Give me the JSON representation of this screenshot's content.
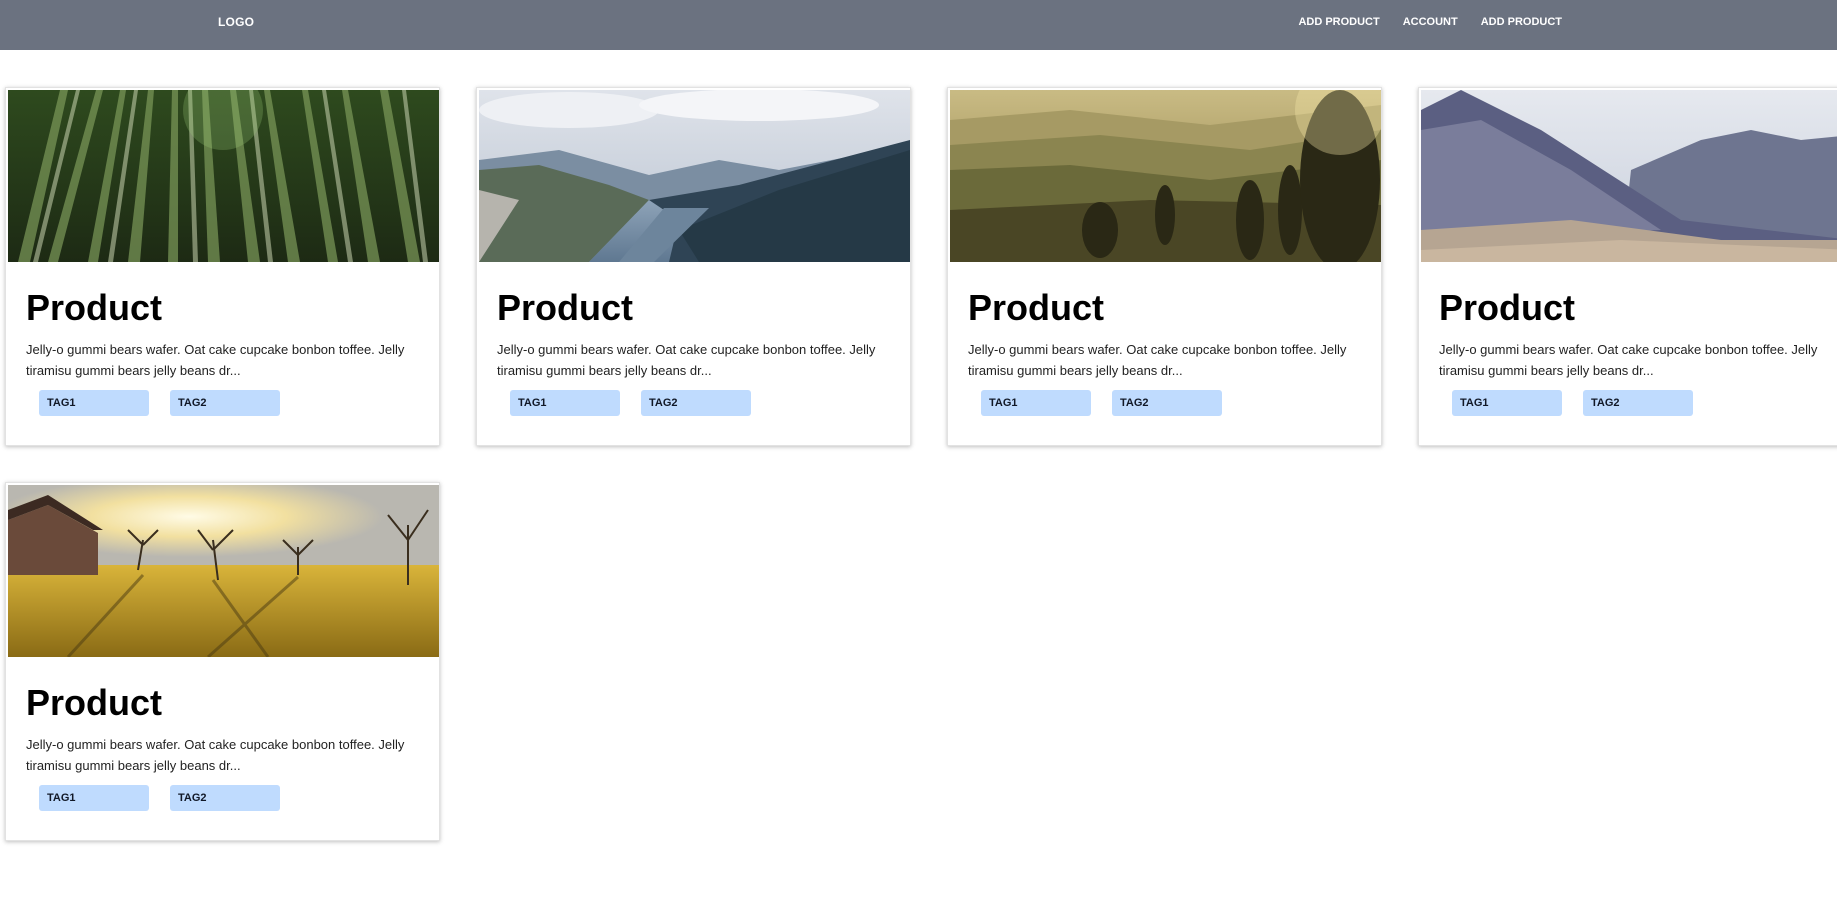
{
  "navbar": {
    "logo": "LOGO",
    "links": [
      "ADD PRODUCT",
      "ACCOUNT",
      "ADD PRODUCT"
    ]
  },
  "products": [
    {
      "title": "Product",
      "description": "Jelly-o gummi bears wafer. Oat cake cupcake bonbon toffee. Jelly tiramisu gummi bears jelly beans dr...",
      "tags": [
        "TAG1",
        "TAG2"
      ],
      "image": "bamboo-forest-image"
    },
    {
      "title": "Product",
      "description": "Jelly-o gummi bears wafer. Oat cake cupcake bonbon toffee. Jelly tiramisu gummi bears jelly beans dr...",
      "tags": [
        "TAG1",
        "TAG2"
      ],
      "image": "fjord-image"
    },
    {
      "title": "Product",
      "description": "Jelly-o gummi bears wafer. Oat cake cupcake bonbon toffee. Jelly tiramisu gummi bears jelly beans dr...",
      "tags": [
        "TAG1",
        "TAG2"
      ],
      "image": "sunset-hills-image"
    },
    {
      "title": "Product",
      "description": "Jelly-o gummi bears wafer. Oat cake cupcake bonbon toffee. Jelly tiramisu gummi bears jelly beans dr...",
      "tags": [
        "TAG1",
        "TAG2"
      ],
      "image": "mountains-image"
    },
    {
      "title": "Product",
      "description": "Jelly-o gummi bears wafer. Oat cake cupcake bonbon toffee. Jelly tiramisu gummi bears jelly beans dr...",
      "tags": [
        "TAG1",
        "TAG2"
      ],
      "image": "sunny-meadow-image"
    }
  ],
  "colors": {
    "navbar_bg": "#6b7280",
    "tag_bg": "#bfdbfe"
  }
}
